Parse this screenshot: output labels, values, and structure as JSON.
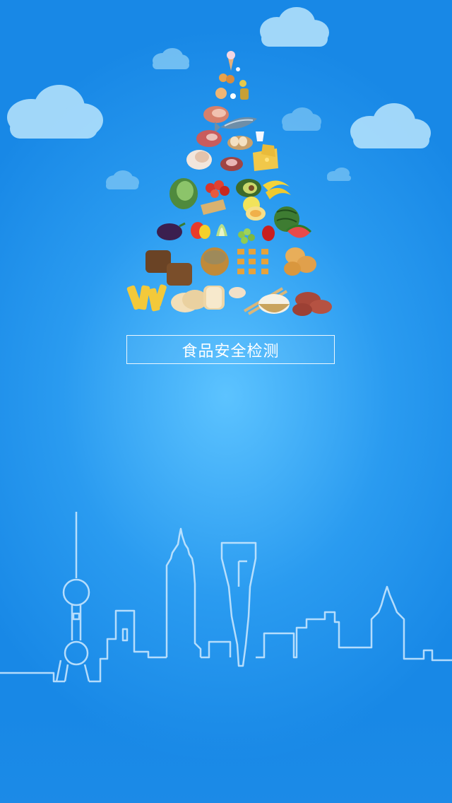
{
  "app": {
    "title_button_label": "食品安全检测"
  },
  "theme": {
    "background": "#2a9bf0",
    "accent_light": "#5cc3ff",
    "line_color": "#cfeaff"
  },
  "illustration": {
    "pyramid_icon": "food-pyramid-icon",
    "skyline_icon": "city-skyline-icon",
    "cloud_icon": "cloud-icon"
  }
}
